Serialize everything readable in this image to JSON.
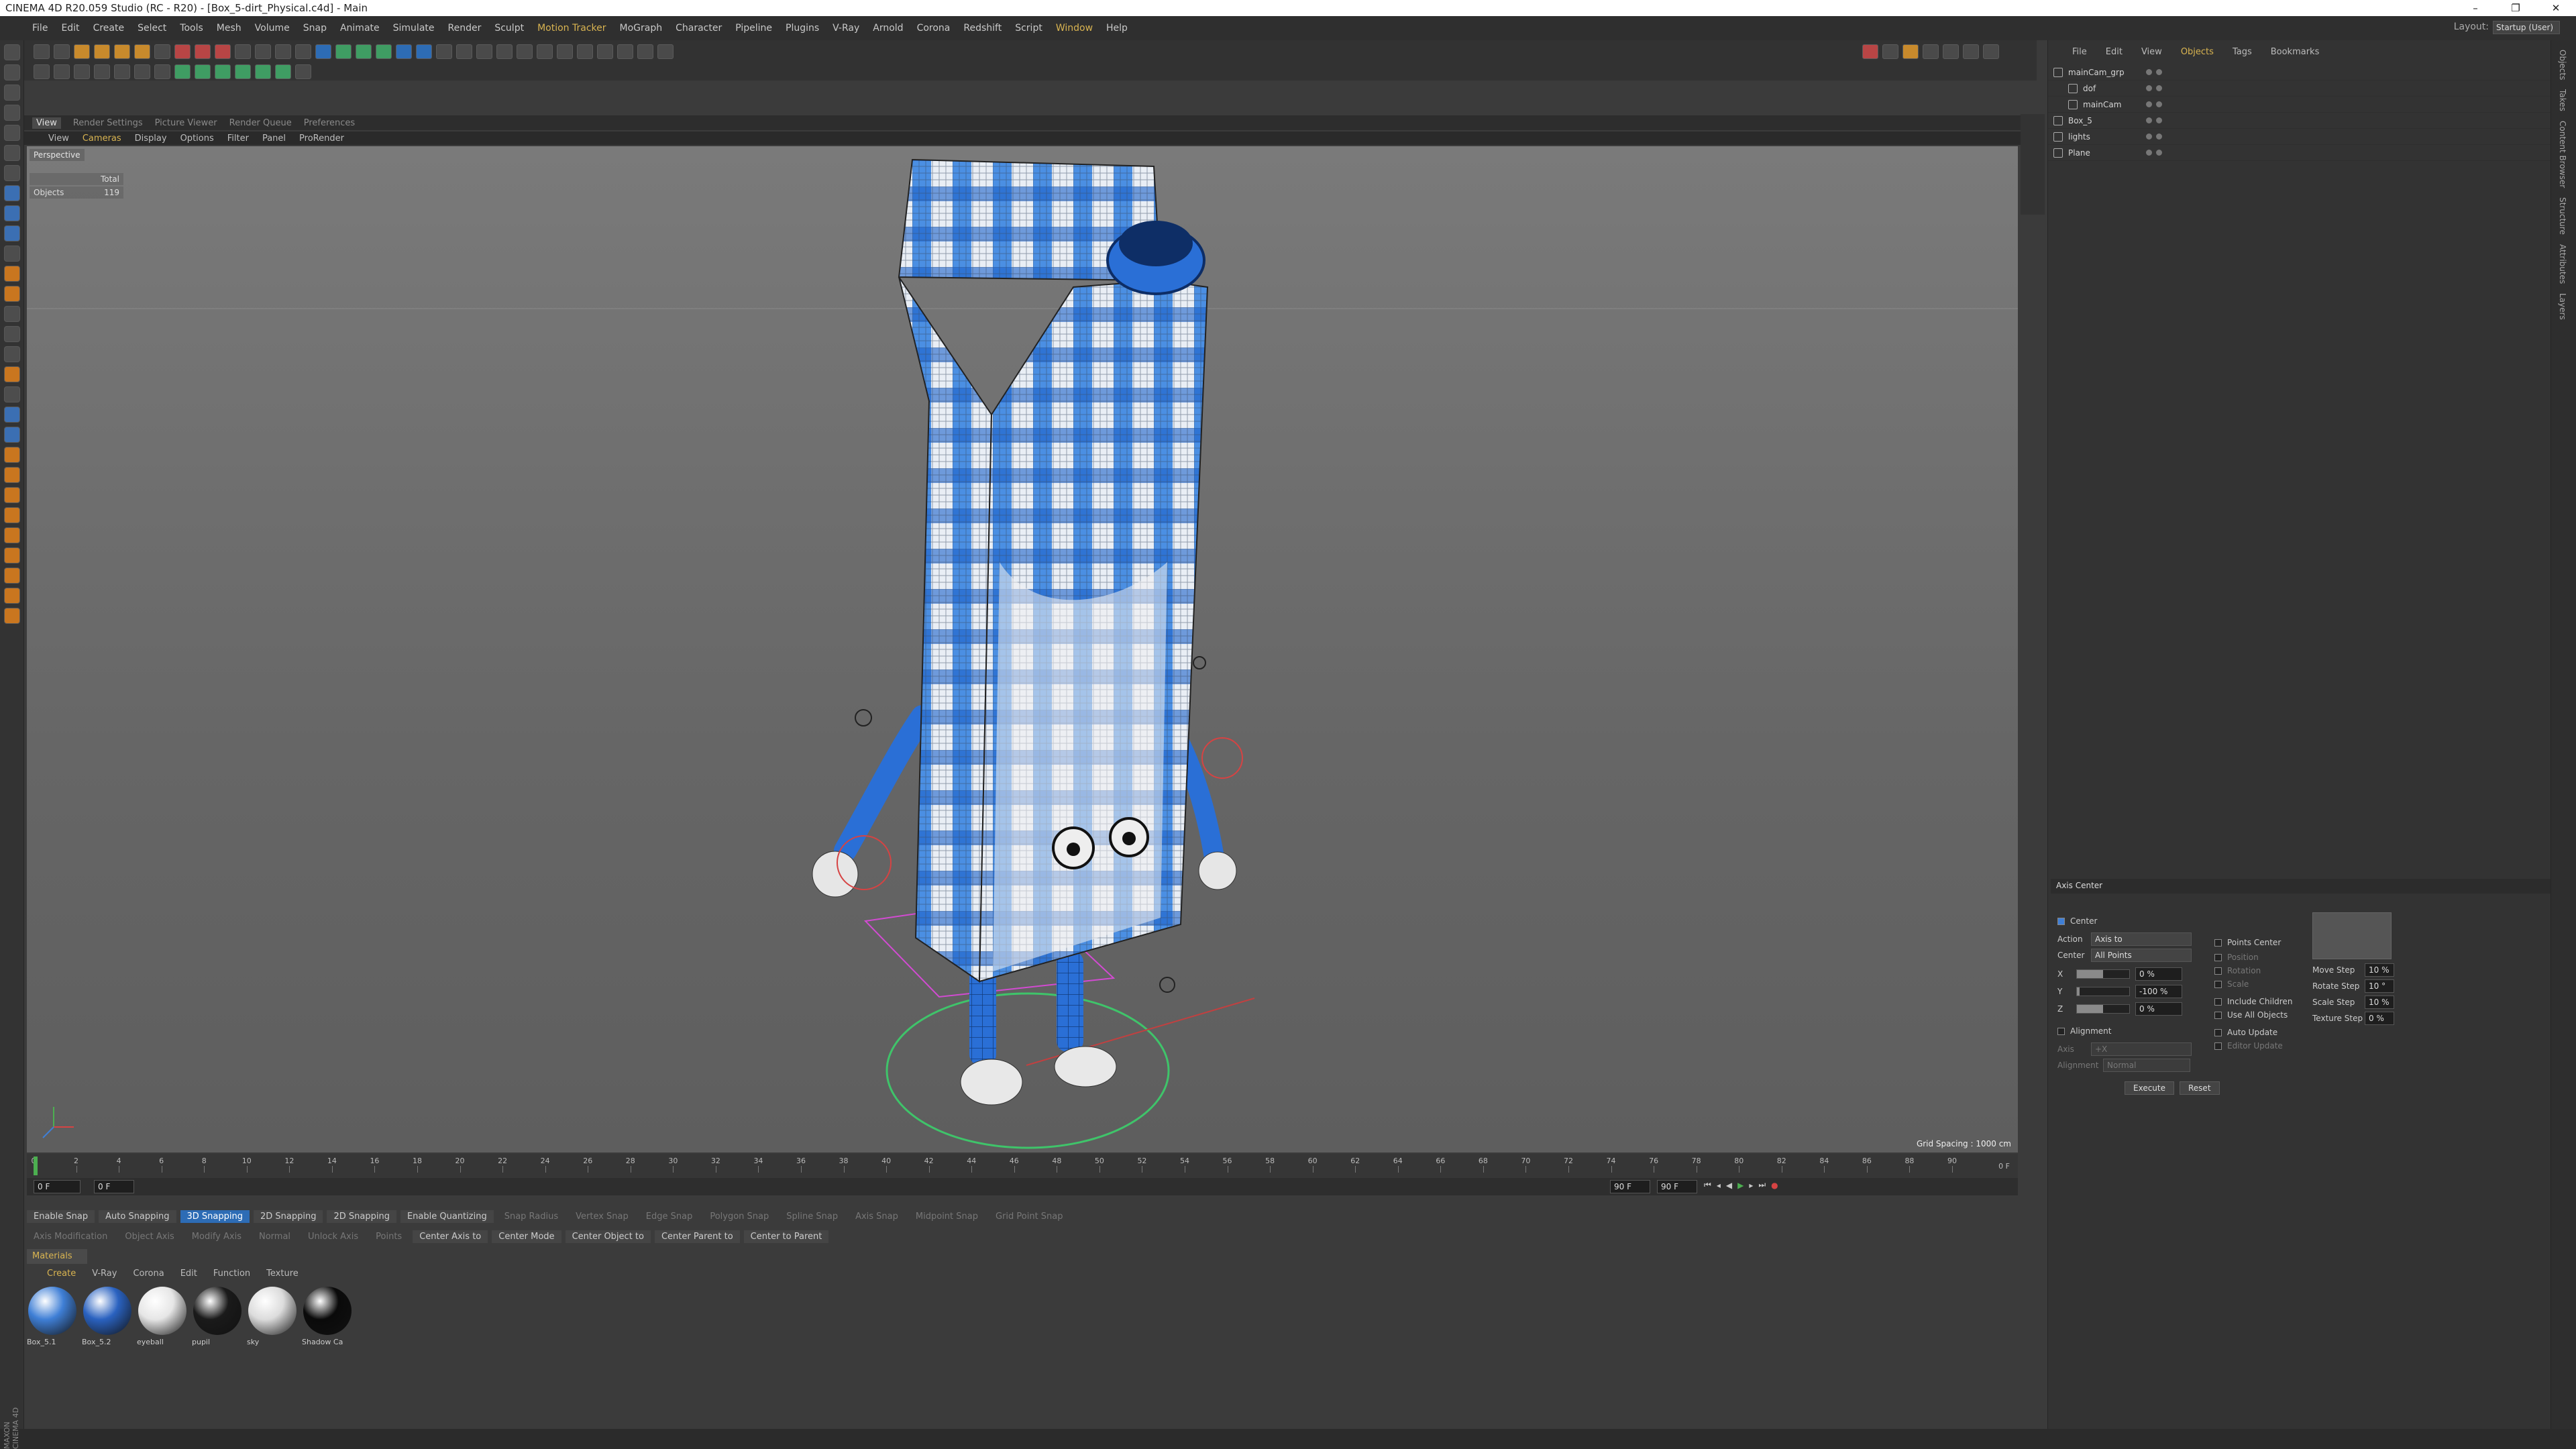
{
  "window": {
    "title": "CINEMA 4D R20.059 Studio (RC - R20) - [Box_5-dirt_Physical.c4d] - Main",
    "minimize": "–",
    "maximize": "❐",
    "close": "✕"
  },
  "menubar": {
    "items": [
      "File",
      "Edit",
      "Create",
      "Select",
      "Tools",
      "Mesh",
      "Volume",
      "Snap",
      "Animate",
      "Simulate",
      "Render",
      "Sculpt",
      "Motion Tracker",
      "MoGraph",
      "Character",
      "Pipeline",
      "Plugins",
      "V-Ray",
      "Arnold",
      "Corona",
      "Redshift",
      "Script",
      "Window",
      "Help"
    ],
    "highlighted": [
      "Motion Tracker",
      "Window"
    ],
    "layout_label": "Layout:",
    "layout_value": "Startup (User)"
  },
  "tabs": [
    "View",
    "Render Settings",
    "Picture Viewer",
    "Render Queue",
    "Preferences"
  ],
  "viewport_menu": [
    "View",
    "Cameras",
    "Display",
    "Options",
    "Filter",
    "Panel",
    "ProRender"
  ],
  "viewport": {
    "label": "Perspective",
    "stats_header": "Total",
    "stats_objects_label": "Objects",
    "stats_objects_value": "119",
    "grid_spacing": "Grid Spacing : 1000 cm"
  },
  "timeline": {
    "ticks": [
      "0",
      "2",
      "4",
      "6",
      "8",
      "10",
      "12",
      "14",
      "16",
      "18",
      "20",
      "22",
      "24",
      "26",
      "28",
      "30",
      "32",
      "34",
      "36",
      "38",
      "40",
      "42",
      "44",
      "46",
      "48",
      "50",
      "52",
      "54",
      "56",
      "58",
      "60",
      "62",
      "64",
      "66",
      "68",
      "70",
      "72",
      "74",
      "76",
      "78",
      "80",
      "82",
      "84",
      "86",
      "88",
      "90"
    ],
    "end_frame_label": "0 F",
    "current_frame": "0 F",
    "start_field": "0 F",
    "end_field": "90 F",
    "max_field": "90 F"
  },
  "snapbar": {
    "items": [
      "Enable Snap",
      "Auto Snapping",
      "3D Snapping",
      "2D Snapping",
      "2D Snapping",
      "Enable Quantizing",
      "Snap Radius",
      "Vertex Snap",
      "Edge Snap",
      "Polygon Snap",
      "Spline Snap",
      "Axis Snap",
      "Midpoint Snap",
      "Grid Point Snap"
    ],
    "active": "3D Snapping"
  },
  "axisbar": {
    "items": [
      "Axis Modification",
      "Object Axis",
      "Modify Axis",
      "Normal",
      "Unlock Axis",
      "Points",
      "Center Axis to",
      "Center Mode",
      "Center Object to",
      "Center Parent to",
      "Center to Parent"
    ]
  },
  "materials": {
    "tab": "Materials",
    "menu": [
      "Create",
      "V-Ray",
      "Corona",
      "Edit",
      "Function",
      "Texture"
    ],
    "items": [
      {
        "name": "Box_5.1",
        "color": "#3f7fd6"
      },
      {
        "name": "Box_5.2",
        "color": "#2a62c0"
      },
      {
        "name": "eyeball",
        "color": "#e6e6e6"
      },
      {
        "name": "pupil",
        "color": "#1a1a1a"
      },
      {
        "name": "sky",
        "color": "#dcdcdc"
      },
      {
        "name": "Shadow Ca",
        "color": "#0a0a0a"
      }
    ]
  },
  "objects": {
    "menu": [
      "File",
      "Edit",
      "View",
      "Objects",
      "Tags",
      "Bookmarks"
    ],
    "active_menu": "Objects",
    "tree": [
      {
        "name": "mainCam_grp",
        "indent": 0
      },
      {
        "name": "dof",
        "indent": 1
      },
      {
        "name": "mainCam",
        "indent": 1
      },
      {
        "name": "Box_5",
        "indent": 0
      },
      {
        "name": "lights",
        "indent": 0
      },
      {
        "name": "Plane",
        "indent": 0
      }
    ]
  },
  "attributes": {
    "title": "Axis Center",
    "center_label": "Center",
    "action_label": "Action",
    "action_value": "Axis to",
    "center_mode_label": "Center",
    "center_mode_value": "All Points",
    "x_label": "X",
    "x_value": "0 %",
    "x_level": 0.5,
    "y_label": "Y",
    "y_value": "-100 %",
    "y_level": 0.0,
    "z_label": "Z",
    "z_value": "0 %",
    "z_level": 0.5,
    "points_center": "Points Center",
    "position": "Position",
    "rotation": "Rotation",
    "scale": "Scale",
    "include_children": "Include Children",
    "use_all_objects": "Use All Objects",
    "auto_update": "Auto Update",
    "editor_update": "Editor Update",
    "alignment_label": "Alignment",
    "axis_label": "Axis",
    "axis_value": "+X",
    "alignment_field_label": "Alignment",
    "alignment_value": "Normal",
    "move_step_label": "Move Step",
    "move_step_value": "10 %",
    "rotate_step_label": "Rotate Step",
    "rotate_step_value": "10 °",
    "scale_step_label": "Scale Step",
    "scale_step_value": "10 %",
    "texture_step_label": "Texture Step",
    "texture_step_value": "0 %",
    "execute": "Execute",
    "reset": "Reset"
  },
  "sidebar_right": [
    "Objects",
    "Takes",
    "Content Browser",
    "Structure",
    "Attributes",
    "Layers"
  ],
  "brand": "MAXON CINEMA 4D"
}
